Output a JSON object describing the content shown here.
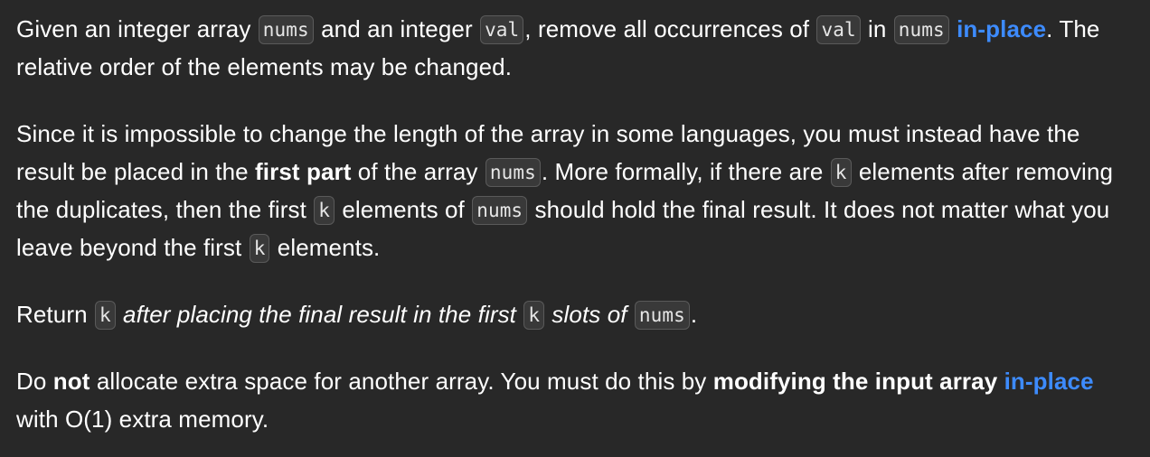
{
  "p1": {
    "t1": "Given an integer array ",
    "c1": "nums",
    "t2": " and an integer ",
    "c2": "val",
    "t3": ", remove all occurrences of ",
    "c3": "val",
    "t4": " in ",
    "c4": "nums",
    "t5": " ",
    "link": "in-place",
    "t6": ". The relative order of the elements may be changed."
  },
  "p2": {
    "t1": "Since it is impossible to change the length of the array in some languages, you must instead have the result be placed in the ",
    "b1": "first part",
    "t2": " of the array ",
    "c1": "nums",
    "t3": ". More formally, if there are ",
    "c2": "k",
    "t4": " elements after removing the duplicates, then the first ",
    "c3": "k",
    "t5": " elements of ",
    "c4": "nums",
    "t6": " should hold the final result. It does not matter what you leave beyond the first ",
    "c5": "k",
    "t7": " elements."
  },
  "p3": {
    "t1": "Return ",
    "c1": "k",
    "i1": " after placing the final result in the first ",
    "c2": "k",
    "i2": " slots of ",
    "c3": "nums",
    "t2": "."
  },
  "p4": {
    "t1": "Do ",
    "b1": "not",
    "t2": " allocate extra space for another array. You must do this by ",
    "b2": "modifying the input array",
    "t3": " ",
    "link": "in-place",
    "t4": " with O(1) extra memory."
  }
}
